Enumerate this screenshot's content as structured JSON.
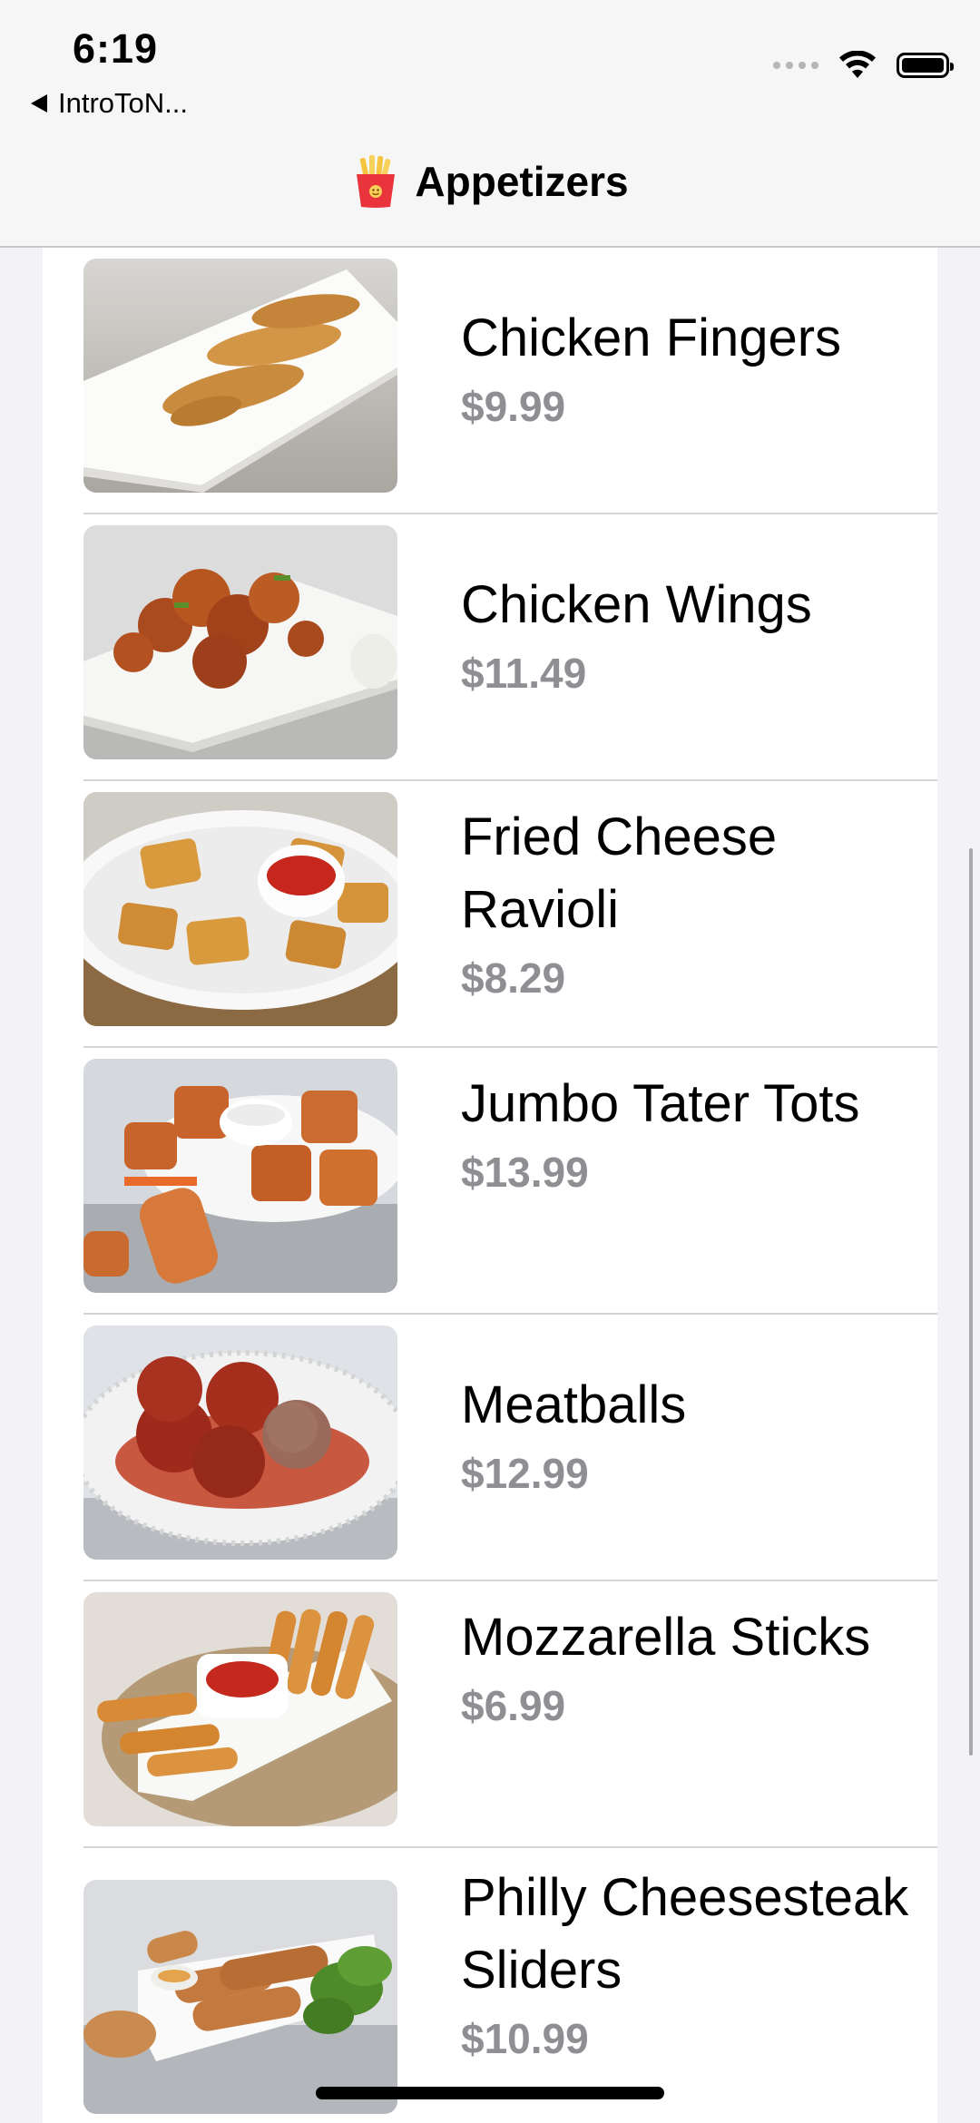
{
  "status_bar": {
    "time": "6:19",
    "back_app": "IntroToN..."
  },
  "nav": {
    "title": "Appetizers",
    "icon": "french-fries-icon"
  },
  "items": [
    {
      "name": "Chicken Fingers",
      "price": "$9.99"
    },
    {
      "name": "Chicken Wings",
      "price": "$11.49"
    },
    {
      "name": "Fried Cheese Ravioli",
      "price": "$8.29"
    },
    {
      "name": "Jumbo Tater Tots",
      "price": "$13.99"
    },
    {
      "name": "Meatballs",
      "price": "$12.99"
    },
    {
      "name": "Mozzarella Sticks",
      "price": "$6.99"
    },
    {
      "name": "Philly Cheesesteak Sliders",
      "price": "$10.99"
    }
  ],
  "colors": {
    "price": "#8e8e93",
    "background": "#f2f2f7",
    "nav_bar": "#f6f6f6"
  }
}
